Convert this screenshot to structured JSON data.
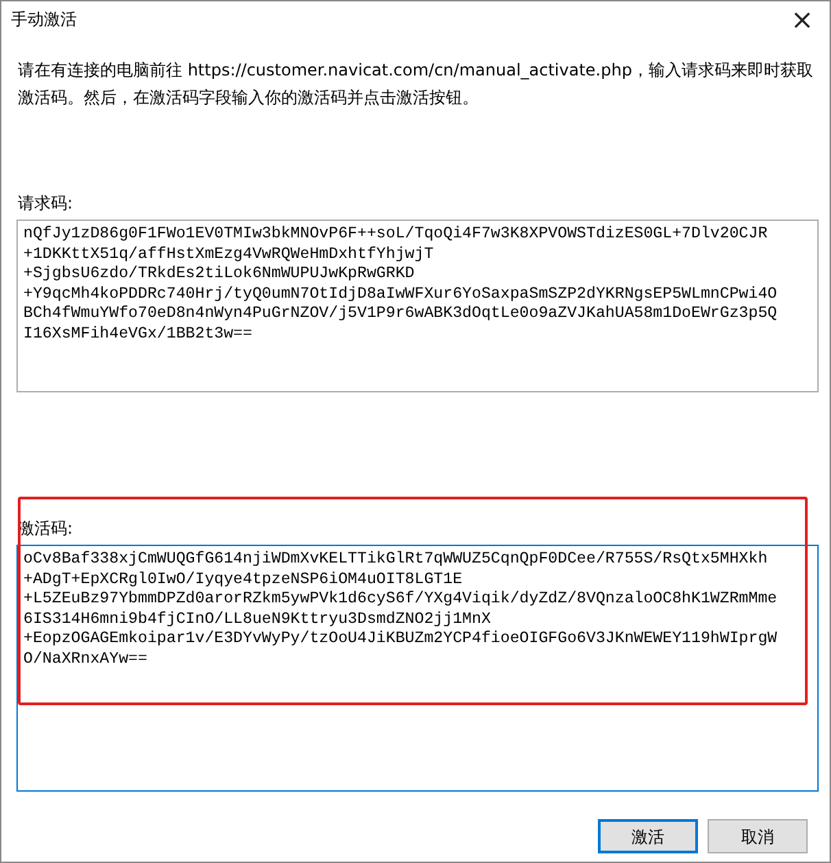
{
  "window": {
    "title": "手动激活",
    "close": "×"
  },
  "instructions": "请在有连接的电脑前往 https://customer.navicat.com/cn/manual_activate.php，输入请求码来即时获取激活码。然后，在激活码字段输入你的激活码并点击激活按钮。",
  "request_code": {
    "label": "请求码:",
    "lines": [
      "nQfJy1zD86g0F1FWo1EV0TMIw3bkMNOvP6F++soL/TqoQi4F7w3K8XPVOWSTdizES0GL+7Dlv20CJR",
      "+1DKKttX51q/affHstXmEzg4VwRQWeHmDxhtfYhjwjT",
      "+SjgbsU6zdo/TRkdEs2tiLok6NmWUPUJwKpRwGRKD",
      "+Y9qcMh4koPDDRc740Hrj/tyQ0umN7OtIdjD8aIwWFXur6YoSaxpaSmSZP2dYKRNgsEP5WLmnCPwi4O",
      "BCh4fWmuYWfo70eD8n4nWyn4PuGrNZOV/j5V1P9r6wABK3dOqtLe0o9aZVJKahUA58m1DoEWrGz3p5Q",
      "I16XsMFih4eVGx/1BB2t3w=="
    ],
    "focused": false
  },
  "activation_code": {
    "label": "激活码:",
    "lines": [
      "oCv8Baf338xjCmWUQGfG614njiWDmXvKELTTikGlRt7qWWUZ5CqnQpF0DCee/R755S/RsQtx5MHXkh",
      "+ADgT+EpXCRgl0IwO/Iyqye4tpzeNSP6iOM4uOIT8LGT1E",
      "+L5ZEuBz97YbmmDPZd0arorRZkm5ywPVk1d6cyS6f/YXg4Viqik/dyZdZ/8VQnzaloOC8hK1WZRmMme",
      "6IS314H6mni9b4fjCInO/LL8ueN9Kttryu3DsmdZNO2jj1MnX",
      "+EopzOGAGEmkoipar1v/E3DYvWyPy/tzOoU4JiKBUZm2YCP4fioeOIGFGo6V3JKnWEWEY119hWIprgW",
      "O/NaXRnxAYw=="
    ],
    "focused": true,
    "highlighted": true
  },
  "buttons": [
    {
      "label": "激活",
      "default": true
    },
    {
      "label": "取消",
      "default": false
    }
  ]
}
